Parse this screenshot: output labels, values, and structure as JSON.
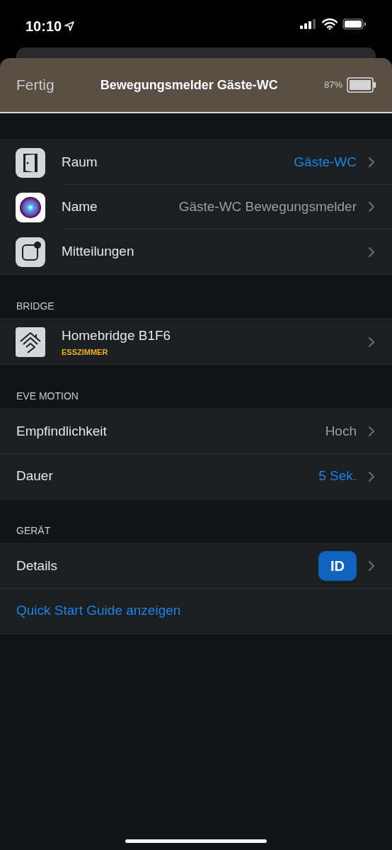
{
  "status_bar": {
    "time": "10:10"
  },
  "nav": {
    "done": "Fertig",
    "title": "Bewegungsmelder Gäste-WC",
    "battery": "87%"
  },
  "sections": [
    {
      "rows": [
        {
          "kind": "room",
          "label": "Raum",
          "value": "Gäste-WC",
          "accent": true
        },
        {
          "kind": "name",
          "label": "Name",
          "value": "Gäste-WC Bewegungsmelder",
          "accent": false
        },
        {
          "kind": "notifications",
          "label": "Mitteilungen"
        }
      ]
    },
    {
      "header": "BRIDGE",
      "rows": [
        {
          "kind": "bridge",
          "label": "Homebridge B1F6",
          "sublabel": "ESSZIMMER"
        }
      ]
    },
    {
      "header": "EVE MOTION",
      "rows": [
        {
          "kind": "option",
          "label": "Empfindlichkeit",
          "value": "Hoch",
          "accent": false
        },
        {
          "kind": "option",
          "label": "Dauer",
          "value": "5 Sek.",
          "accent": true
        }
      ]
    },
    {
      "header": "GERÄT",
      "rows": [
        {
          "kind": "badge",
          "label": "Details",
          "badge": "ID"
        },
        {
          "kind": "link",
          "label": "Quick Start Guide anzeigen"
        }
      ]
    }
  ]
}
